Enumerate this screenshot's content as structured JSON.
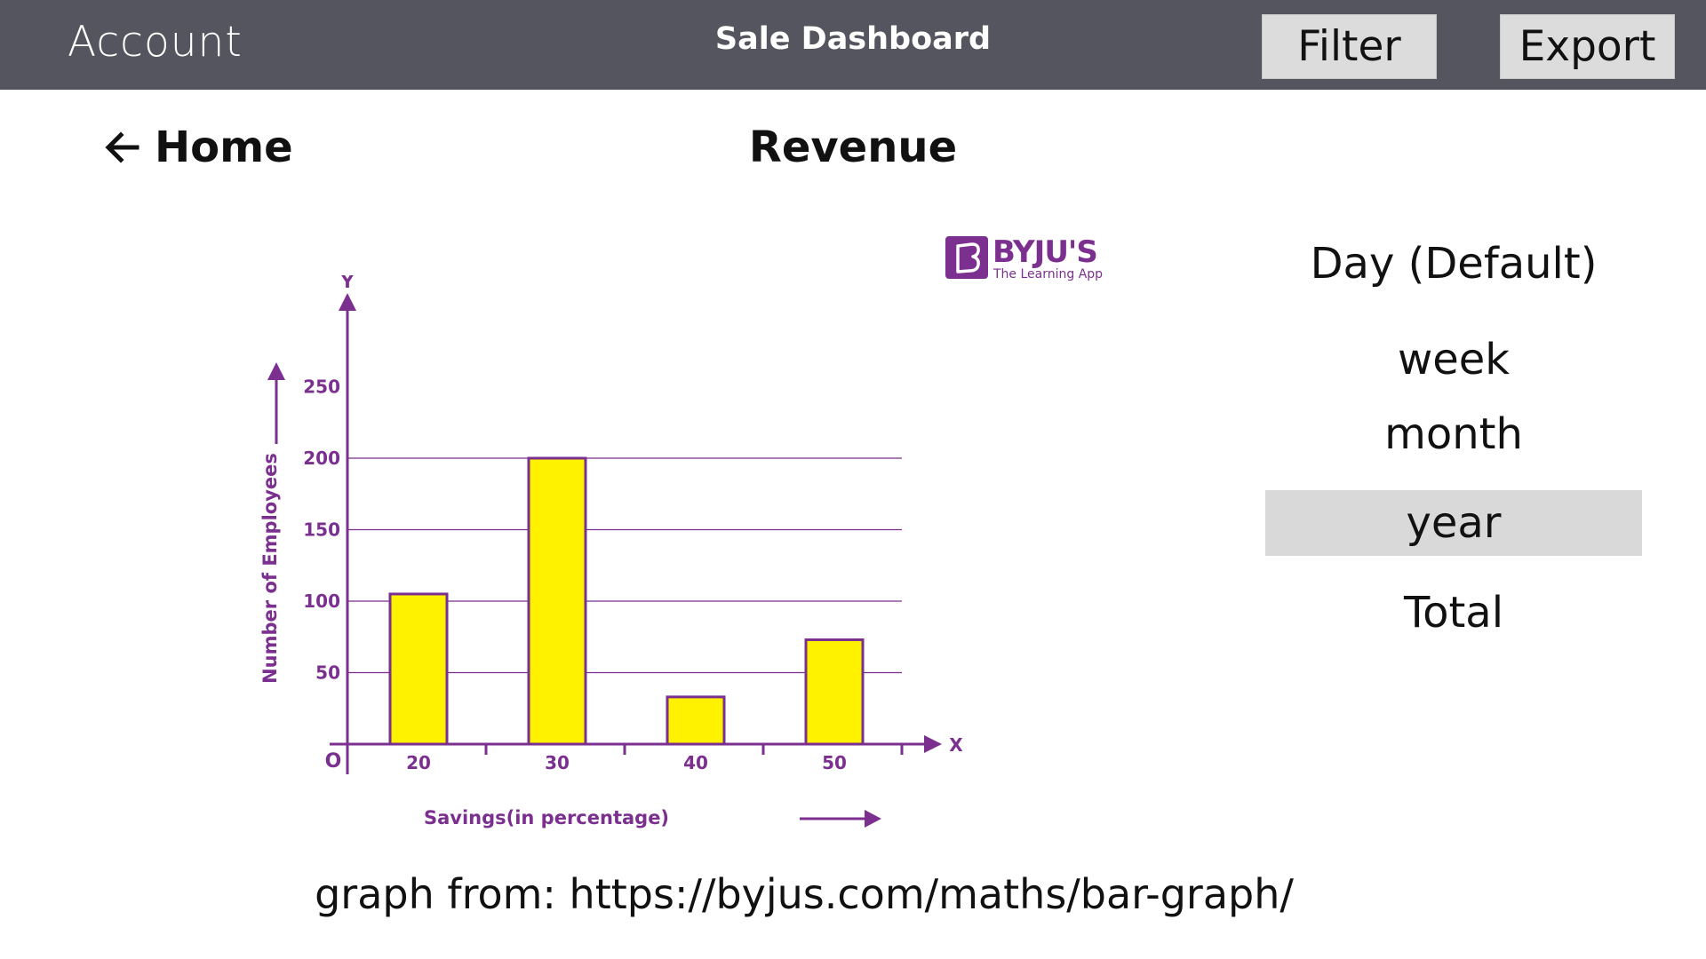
{
  "header": {
    "account_label": "Account",
    "title": "Sale Dashboard",
    "filter_label": "Filter",
    "export_label": "Export"
  },
  "nav": {
    "home_label": "Home"
  },
  "main": {
    "heading": "Revenue"
  },
  "periods": {
    "items": [
      "Day (Default)",
      "week",
      "month",
      "year",
      "Total"
    ],
    "selected": "year"
  },
  "logo": {
    "name": "BYJU'S",
    "tagline": "The Learning App",
    "letter": "B"
  },
  "chart_data": {
    "type": "bar",
    "categories": [
      "20",
      "30",
      "40",
      "50"
    ],
    "values": [
      105,
      200,
      33,
      73
    ],
    "xlabel": "Savings(in percentage)",
    "ylabel": "Number of Employees",
    "x_axis_letter": "X",
    "y_axis_letter": "Y",
    "origin_label": "O",
    "yticks": [
      50,
      100,
      150,
      200,
      250
    ],
    "ylim": [
      0,
      250
    ],
    "grid": true,
    "bar_color": "#fff200",
    "accent_color": "#7b2f8f"
  },
  "credit": "graph from: https://byjus.com/maths/bar-graph/",
  "colors": {
    "topbar": "#55555f",
    "button_bg": "#dcdcdc",
    "selected_bg": "#d9d9d9"
  }
}
